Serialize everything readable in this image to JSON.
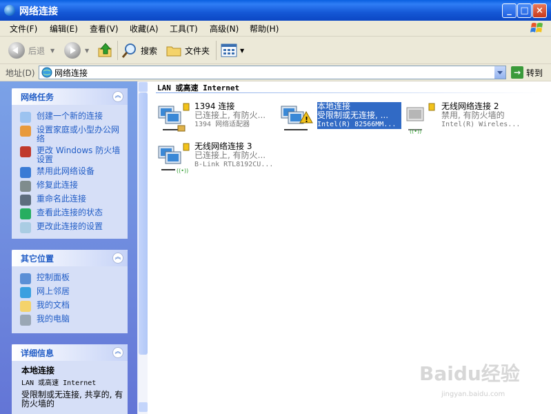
{
  "window": {
    "title": "网络连接"
  },
  "menu": [
    "文件(F)",
    "编辑(E)",
    "查看(V)",
    "收藏(A)",
    "工具(T)",
    "高级(N)",
    "帮助(H)"
  ],
  "toolbar": {
    "back": "后退",
    "search": "搜索",
    "folders": "文件夹"
  },
  "address": {
    "label": "地址(D)",
    "value": "网络连接",
    "go": "转到"
  },
  "tasks": {
    "title": "网络任务",
    "items": [
      "创建一个新的连接",
      "设置家庭或小型办公网络",
      "更改 Windows 防火墙设置",
      "禁用此网络设备",
      "修复此连接",
      "重命名此连接",
      "查看此连接的状态",
      "更改此连接的设置"
    ]
  },
  "places": {
    "title": "其它位置",
    "items": [
      "控制面板",
      "网上邻居",
      "我的文档",
      "我的电脑"
    ]
  },
  "details": {
    "title": "详细信息",
    "name": "本地连接",
    "type": "LAN 或高速 Internet",
    "status": "受限制或无连接, 共享的, 有防火墙的"
  },
  "group": {
    "header": "LAN 或高速 Internet"
  },
  "connections": [
    {
      "name": "1394 连接",
      "status": "已连接上, 有防火...",
      "device": "1394 网络适配器"
    },
    {
      "name": "本地连接",
      "status": "受限制或无连接, ...",
      "device": "Intel(R) 82566MM..."
    },
    {
      "name": "无线网络连接 2",
      "status": "禁用, 有防火墙的",
      "device": "Intel(R) Wireles..."
    },
    {
      "name": "无线网络连接 3",
      "status": "已连接上, 有防火...",
      "device": "B-Link RTL8192CU..."
    }
  ],
  "watermark": {
    "brand": "Baidu经验",
    "url": "jingyan.baidu.com"
  }
}
